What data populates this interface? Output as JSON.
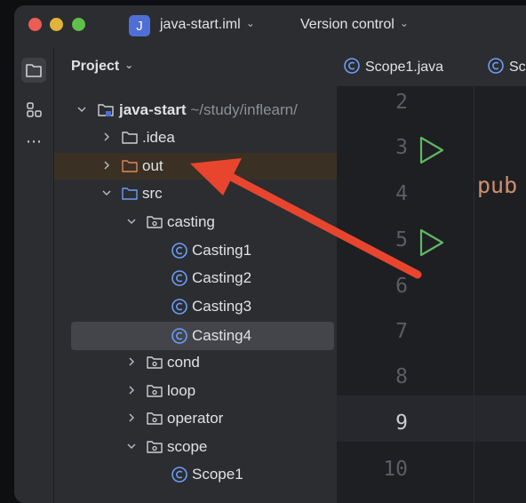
{
  "titlebar": {
    "project_initial": "J",
    "project_name": "java-start.iml",
    "version_control": "Version control"
  },
  "sidebar": {
    "title": "Project",
    "tree": [
      {
        "label": "java-start",
        "path": " ~/study/inflearn/",
        "type": "module",
        "expanded": true
      },
      {
        "label": ".idea",
        "type": "folder",
        "expanded": false
      },
      {
        "label": "out",
        "type": "folder-excluded",
        "expanded": false
      },
      {
        "label": "src",
        "type": "folder-source",
        "expanded": true
      },
      {
        "label": "casting",
        "type": "package",
        "expanded": true
      },
      {
        "label": "Casting1",
        "type": "class"
      },
      {
        "label": "Casting2",
        "type": "class"
      },
      {
        "label": "Casting3",
        "type": "class"
      },
      {
        "label": "Casting4",
        "type": "class",
        "selected": true
      },
      {
        "label": "cond",
        "type": "package",
        "expanded": false
      },
      {
        "label": "loop",
        "type": "package",
        "expanded": false
      },
      {
        "label": "operator",
        "type": "package",
        "expanded": false
      },
      {
        "label": "scope",
        "type": "package",
        "expanded": true
      },
      {
        "label": "Scope1",
        "type": "class"
      }
    ]
  },
  "editor": {
    "tabs": [
      {
        "label": "Scope1.java"
      },
      {
        "label": "Sc"
      }
    ],
    "line_numbers": [
      "2",
      "3",
      "4",
      "5",
      "6",
      "7",
      "8",
      "9",
      "10"
    ],
    "current_line": "9",
    "code_fragment": "pub"
  },
  "colors": {
    "accent": "#4f6fd6",
    "annotation_arrow": "#e8452f",
    "run_icon": "#5fb865",
    "class_icon": "#6e9cf5"
  }
}
